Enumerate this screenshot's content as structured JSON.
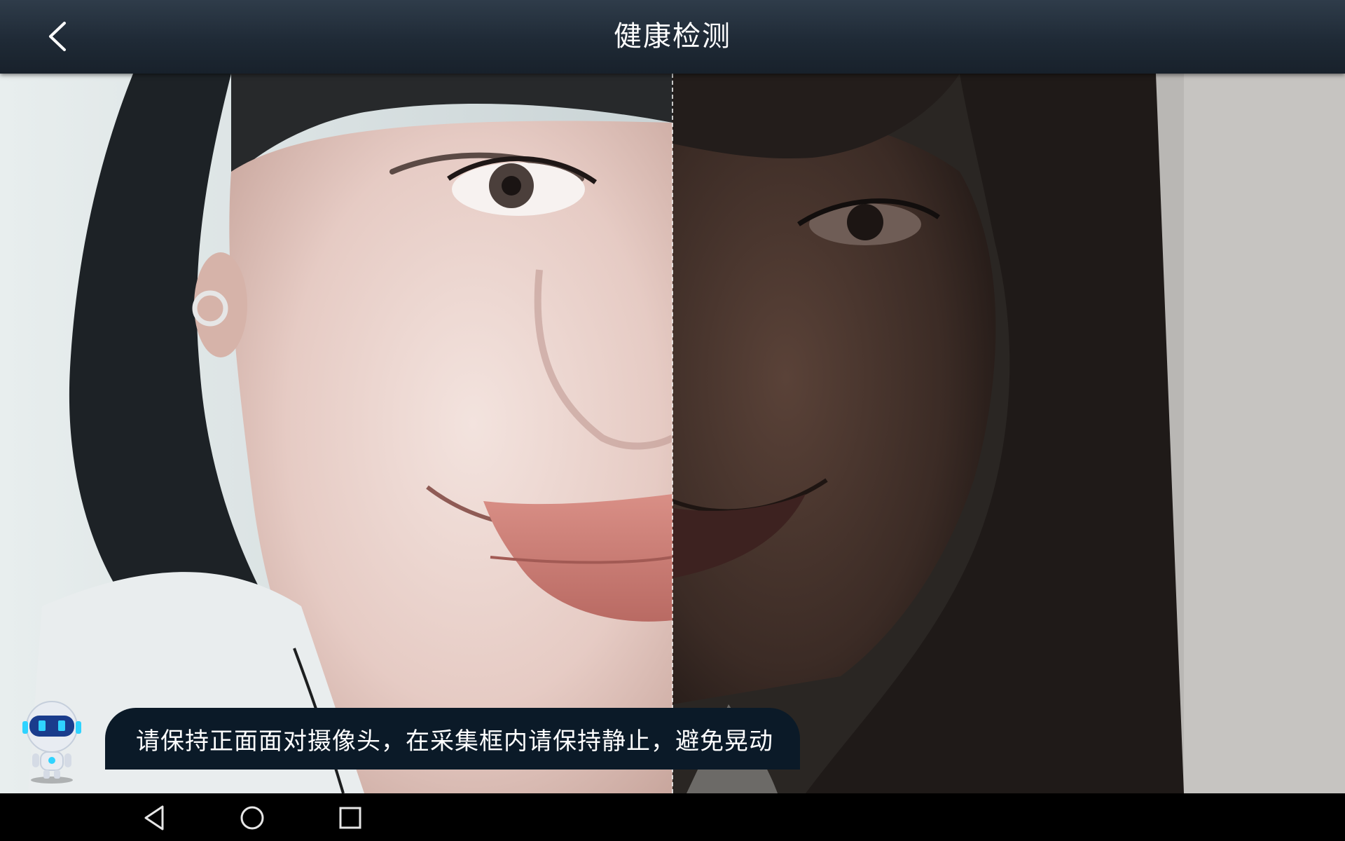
{
  "header": {
    "title": "健康检测",
    "back_icon": "chevron-left-icon"
  },
  "camera": {
    "guide": "dashed-center-line"
  },
  "tip": {
    "text": "请保持正面面对摄像头，在采集框内请保持静止，避免晃动",
    "mascot_icon": "robot-icon"
  },
  "nav_bar": {
    "back_icon": "triangle-back-icon",
    "home_icon": "circle-home-icon",
    "recents_icon": "square-recents-icon"
  },
  "colors": {
    "header_bg": "#1f2a36",
    "tip_bg": "#0b1a28",
    "nav_bg": "#000000",
    "text": "#ffffff",
    "robot_accent": "#2fd3ff"
  }
}
